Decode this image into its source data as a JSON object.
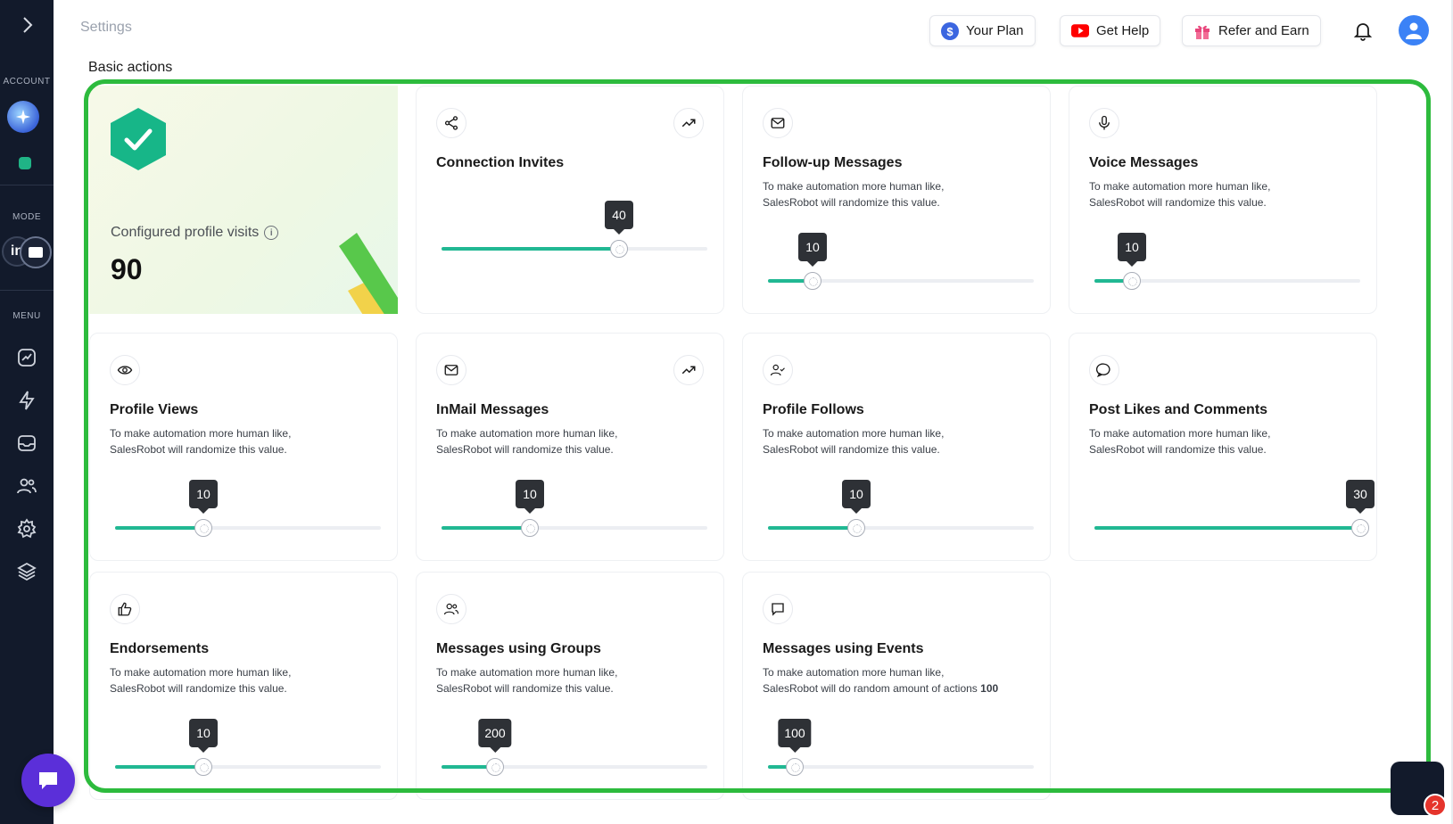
{
  "sidebar": {
    "sections": {
      "account": "ACCOUNT",
      "mode": "MODE",
      "menu": "MENU"
    },
    "mode_label": "in"
  },
  "header": {
    "title": "Settings",
    "your_plan": "Your Plan",
    "get_help": "Get Help",
    "refer_and_earn": "Refer and Earn"
  },
  "section_title": "Basic actions",
  "feature": {
    "label": "Configured profile visits",
    "info_glyph": "i",
    "value": "90"
  },
  "cards": [
    {
      "title": "Connection Invites",
      "desc1": "",
      "desc2": "",
      "value": "40",
      "fraction": 0.667
    },
    {
      "title": "Follow-up Messages",
      "desc1": "To make automation more human like,",
      "desc2": "SalesRobot will randomize this value.",
      "value": "10",
      "fraction": 0.167
    },
    {
      "title": "Voice Messages",
      "desc1": "To make automation more human like,",
      "desc2": "SalesRobot will randomize this value.",
      "value": "10",
      "fraction": 0.14
    },
    {
      "title": "Profile Views",
      "desc1": "To make automation more human like,",
      "desc2": "SalesRobot will randomize this value.",
      "value": "10",
      "fraction": 0.333
    },
    {
      "title": "InMail Messages",
      "desc1": "To make automation more human like,",
      "desc2": "SalesRobot will randomize this value.",
      "value": "10",
      "fraction": 0.333
    },
    {
      "title": "Profile Follows",
      "desc1": "To make automation more human like,",
      "desc2": "SalesRobot will randomize this value.",
      "value": "10",
      "fraction": 0.333
    },
    {
      "title": "Post Likes and Comments",
      "desc1": "To make automation more human like,",
      "desc2": "SalesRobot will randomize this value.",
      "value": "30",
      "fraction": 1.0
    },
    {
      "title": "Endorsements",
      "desc1": "To make automation more human like,",
      "desc2": "SalesRobot will randomize this value.",
      "value": "10",
      "fraction": 0.333
    },
    {
      "title": "Messages using Groups",
      "desc1": "To make automation more human like,",
      "desc2": "SalesRobot will randomize this value.",
      "value": "200",
      "fraction": 0.2
    },
    {
      "title": "Messages using Events",
      "desc1": "To make automation more human like,",
      "desc2": "SalesRobot will do random amount of actions",
      "desc2_bold": "100",
      "value": "100",
      "fraction": 0.1
    }
  ],
  "notification_count": "2",
  "colors": {
    "accent": "#21b893",
    "highlight": "#2dbb3d",
    "sidebar": "#121a2b",
    "chat": "#5b2fd9"
  }
}
